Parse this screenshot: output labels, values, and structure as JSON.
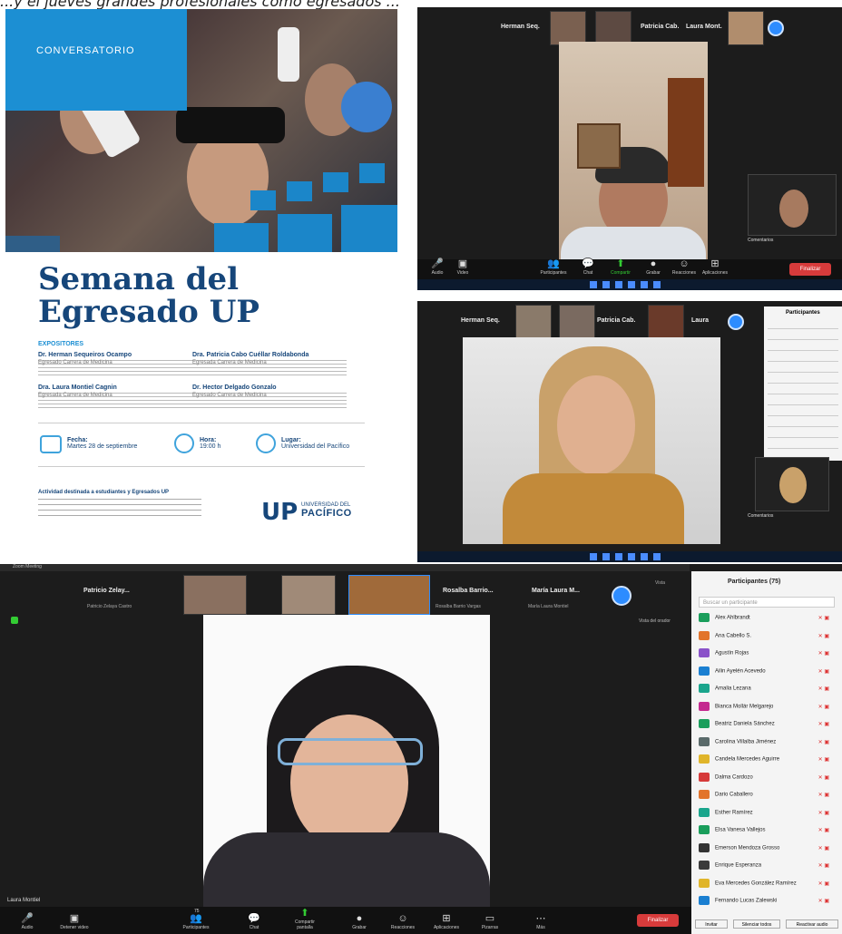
{
  "caption": "...y el jueves grandes profesionales como egresados ...",
  "poster": {
    "label": "CONVERSATORIO",
    "title_line1": "Semana del",
    "title_line2": "Egresado UP",
    "speakers_heading": "EXPOSITORES",
    "speakers": [
      {
        "name": "Dr. Herman Sequeiros Ocampo",
        "desc": "Egresado Carrera de Medicina"
      },
      {
        "name": "Dra. Patricia Cabo Cuéllar Roldabonda",
        "desc": "Egresada Carrera de Medicina"
      },
      {
        "name": "Dra. Laura Montiel Cagnin",
        "desc": "Egresada Carrera de Medicina"
      },
      {
        "name": "Dr. Hector Delgado Gonzalo",
        "desc": "Egresado Carrera de Medicina"
      }
    ],
    "date_label": "Fecha:",
    "date_value": "Martes 28 de septiembre",
    "time_label": "Hora:",
    "time_value": "19:00 h",
    "place_label": "Lugar:",
    "place_value": "Universidad del Pacífico",
    "footer_line1": "Actividad destinada a estudiantes y Egresados UP",
    "logo_mark": "UP",
    "logo_small": "UNIVERSIDAD DEL",
    "logo_big": "PACÍFICO"
  },
  "win1": {
    "names": [
      "Herman Seq.",
      "Patricia Cab.",
      "Laura Mont."
    ],
    "chat_title": "Comentarios",
    "toolbar": [
      "Audio",
      "Video",
      "Participantes",
      "Chat",
      "Compartir",
      "Grabar",
      "Reacciones",
      "Aplicaciones"
    ]
  },
  "win2": {
    "names": [
      "Herman Seq.",
      "Patricia Cab.",
      "Laura"
    ],
    "panel_title": "Participantes",
    "chat_title": "Comentarios"
  },
  "win3": {
    "title": "Zoom Meeting",
    "top_names": [
      {
        "name": "Patricio Zelay...",
        "sub": "Patricio Zelaya Castro"
      },
      {
        "name": "Rosalba Barrio...",
        "sub": "Rosalba Barrio Vargas"
      },
      {
        "name": "María Laura M...",
        "sub": "María Laura Montiel"
      }
    ],
    "view_label": "Vista",
    "speaker_view": "Vista del orador",
    "presenter": "Laura Montiel",
    "participants_title": "Participantes (75)",
    "search_placeholder": "Buscar un participante",
    "participants": [
      {
        "name": "Alex Ahlbrandt",
        "color": "#1a9e5b"
      },
      {
        "name": "Ana Cabello S.",
        "color": "#e2742b"
      },
      {
        "name": "Agustín Rojas",
        "color": "#8a52c9"
      },
      {
        "name": "Ailin Ayelén Acevedo",
        "color": "#1a7fd1"
      },
      {
        "name": "Amalia Lezana",
        "color": "#1aa58c"
      },
      {
        "name": "Bianca Mollár Melgarejo",
        "color": "#c4298f"
      },
      {
        "name": "Beatriz Daniela Sánchez",
        "color": "#1a9e5b"
      },
      {
        "name": "Carolina Villalba Jiménez",
        "color": "#5a6a6a"
      },
      {
        "name": "Candela Mercedes Aguirre",
        "color": "#e0b52a"
      },
      {
        "name": "Dalma Cardozo",
        "color": "#d63a3a"
      },
      {
        "name": "Dario Caballero",
        "color": "#e2742b"
      },
      {
        "name": "Esther Ramírez",
        "color": "#1aa58c"
      },
      {
        "name": "Elsa Vanesa Vallejos",
        "color": "#1a9e5b"
      },
      {
        "name": "Emerson Mendoza Grosso",
        "color": "#333333"
      },
      {
        "name": "Enrique Esperanza",
        "color": "#3a3a3a"
      },
      {
        "name": "Eva Mercedes González Ramírez",
        "color": "#e0b52a"
      },
      {
        "name": "Fernando Lucas Zalewski",
        "color": "#1a7fd1"
      }
    ],
    "btn_invite": "Invitar",
    "btn_mute_all": "Silenciar todos",
    "btn_more": "Reactivar audio",
    "toolbar": [
      "Audio",
      "Detener video",
      "Participantes",
      "Chat",
      "Compartir pantalla",
      "Grabar",
      "Reacciones",
      "Aplicaciones",
      "Pizarras",
      "Más"
    ],
    "participant_count": "75",
    "end_label": "Finalizar"
  }
}
